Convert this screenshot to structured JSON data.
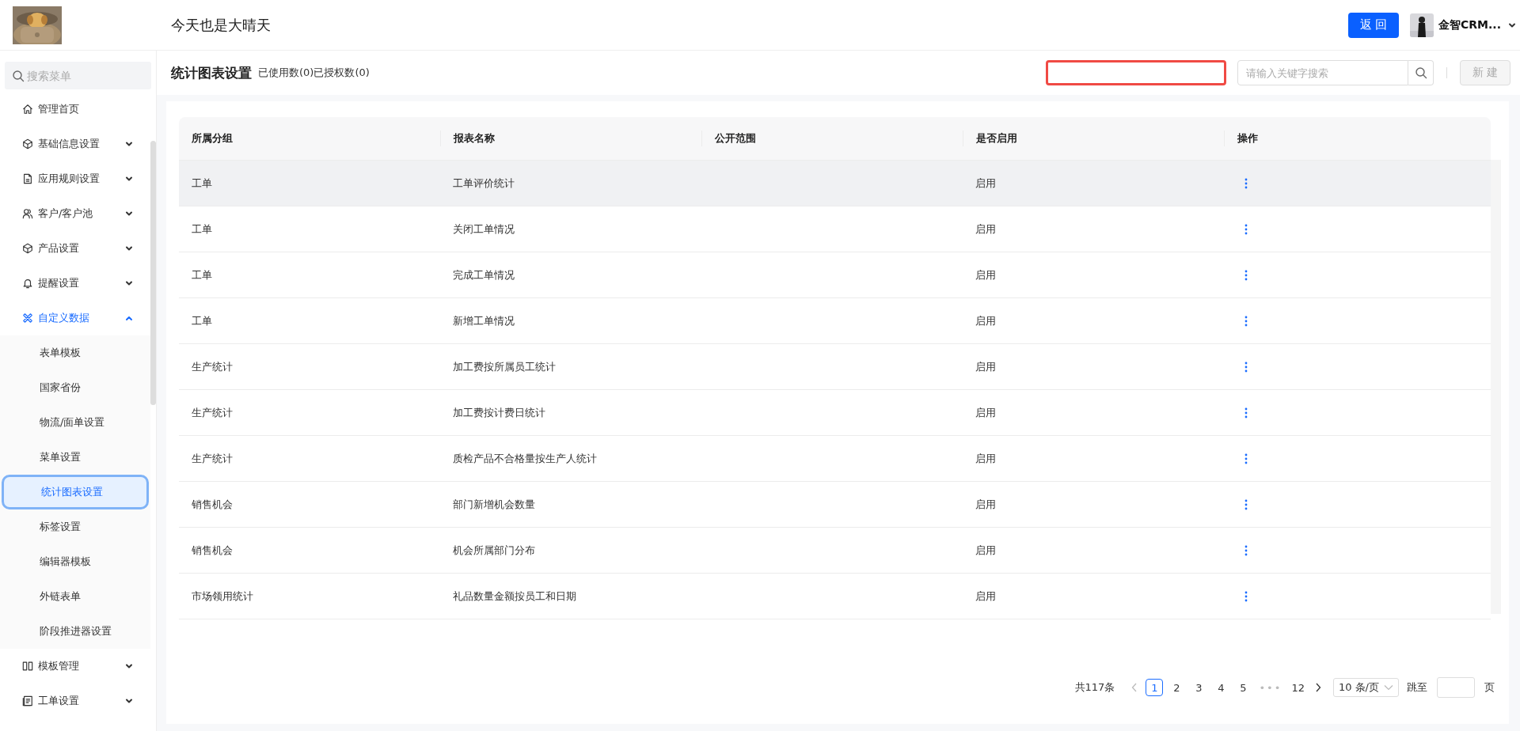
{
  "header": {
    "title": "今天也是大晴天",
    "back_button": "返 回",
    "user_name": "金智CRM..."
  },
  "sidebar": {
    "search_placeholder": "搜索菜单",
    "items": [
      {
        "label": "管理首页"
      },
      {
        "label": "基础信息设置",
        "expanded": false
      },
      {
        "label": "应用规则设置",
        "expanded": false
      },
      {
        "label": "客户/客户池",
        "expanded": false
      },
      {
        "label": "产品设置",
        "expanded": false
      },
      {
        "label": "提醒设置",
        "expanded": false
      },
      {
        "label": "自定义数据",
        "expanded": true,
        "children": [
          {
            "label": "表单模板",
            "selected": false
          },
          {
            "label": "国家省份",
            "selected": false
          },
          {
            "label": "物流/面单设置",
            "selected": false
          },
          {
            "label": "菜单设置",
            "selected": false
          },
          {
            "label": "统计图表设置",
            "selected": true
          },
          {
            "label": "标签设置",
            "selected": false
          },
          {
            "label": "编辑器模板",
            "selected": false
          },
          {
            "label": "外链表单",
            "selected": false
          },
          {
            "label": "阶段推进器设置",
            "selected": false
          }
        ]
      },
      {
        "label": "模板管理",
        "expanded": false
      },
      {
        "label": "工单设置",
        "expanded": false
      }
    ]
  },
  "page": {
    "title": "统计图表设置",
    "subtitle": "已使用数(0)已授权数(0)",
    "search_placeholder": "请输入关键字搜索",
    "new_button": "新 建"
  },
  "table": {
    "columns": [
      "所属分组",
      "报表名称",
      "公开范围",
      "是否启用",
      "操作"
    ],
    "rows": [
      {
        "group": "工单",
        "name": "工单评价统计",
        "status": "启用",
        "selected": true
      },
      {
        "group": "工单",
        "name": "关闭工单情况",
        "status": "启用",
        "selected": false
      },
      {
        "group": "工单",
        "name": "完成工单情况",
        "status": "启用",
        "selected": false
      },
      {
        "group": "工单",
        "name": "新增工单情况",
        "status": "启用",
        "selected": false
      },
      {
        "group": "生产统计",
        "name": "加工费按所属员工统计",
        "status": "启用",
        "selected": false
      },
      {
        "group": "生产统计",
        "name": "加工费按计费日统计",
        "status": "启用",
        "selected": false
      },
      {
        "group": "生产统计",
        "name": "质检产品不合格量按生产人统计",
        "status": "启用",
        "selected": false
      },
      {
        "group": "销售机会",
        "name": "部门新增机会数量",
        "status": "启用",
        "selected": false
      },
      {
        "group": "销售机会",
        "name": "机会所属部门分布",
        "status": "启用",
        "selected": false
      },
      {
        "group": "市场领用统计",
        "name": "礼品数量金额按员工和日期",
        "status": "启用",
        "selected": false
      }
    ]
  },
  "pagination": {
    "total": "共117条",
    "pages": [
      {
        "label": "1",
        "selected": true
      },
      {
        "label": "2",
        "selected": false
      },
      {
        "label": "3",
        "selected": false
      },
      {
        "label": "4",
        "selected": false
      },
      {
        "label": "5",
        "selected": false
      },
      {
        "label": "•••",
        "selected": false
      },
      {
        "label": "12",
        "selected": false
      }
    ],
    "page_size": "10 条/页",
    "jump_label": "跳至",
    "page_suffix": "页"
  }
}
